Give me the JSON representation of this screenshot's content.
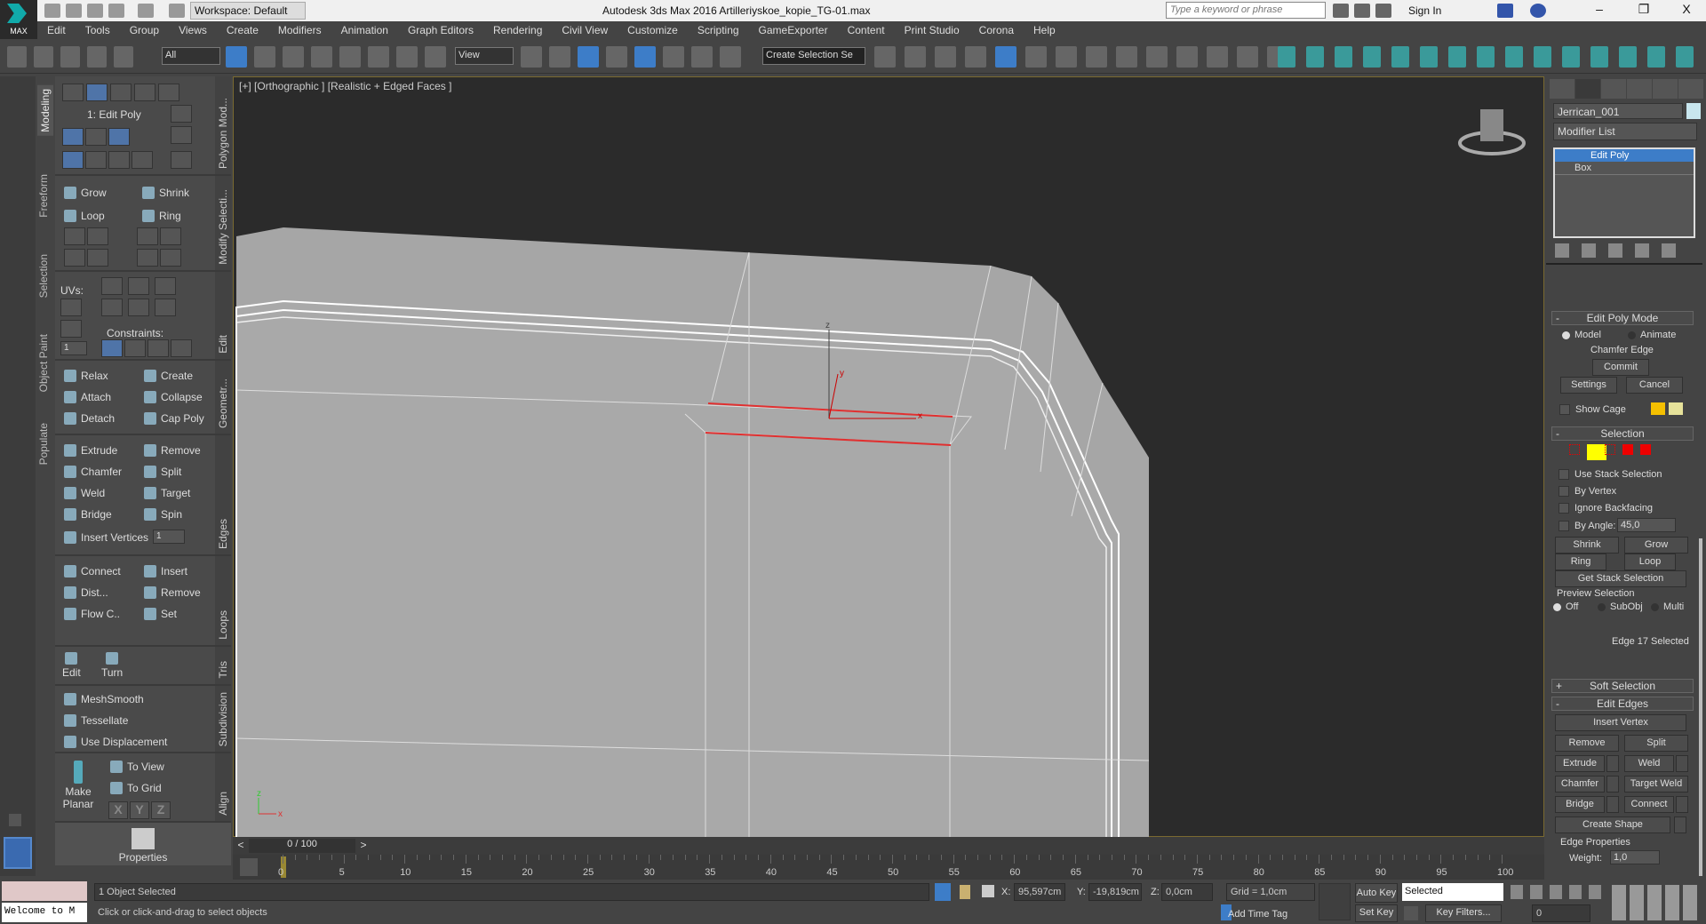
{
  "titlebar": {
    "workspace": "Workspace: Default",
    "app_title": "Autodesk 3ds Max 2016    Artilleriyskoe_kopie_TG-01.max",
    "search_placeholder": "Type a keyword or phrase",
    "sign_in": "Sign In",
    "logo": "MAX",
    "minimize": "–",
    "restore": "❐",
    "close": "X"
  },
  "menu": [
    "Edit",
    "Tools",
    "Group",
    "Views",
    "Create",
    "Modifiers",
    "Animation",
    "Graph Editors",
    "Rendering",
    "Civil View",
    "Customize",
    "Scripting",
    "GameExporter",
    "Content",
    "Print Studio",
    "Corona",
    "Help"
  ],
  "toolbar": {
    "selection_filter": "All",
    "ref_coord": "View",
    "named_sel": "Create Selection Se",
    "snap_value": "3"
  },
  "ribbon_tabs": [
    "Modeling",
    "Freeform",
    "Selection",
    "Object Paint",
    "Populate"
  ],
  "ribbon": {
    "polygon_modeling": {
      "title": "Polygon Mod...",
      "stack_label": "1: Edit Poly"
    },
    "modify_selection": {
      "title": "Modify Selecti...",
      "grow": "Grow",
      "shrink": "Shrink",
      "loop": "Loop",
      "ring": "Ring"
    },
    "edit": {
      "title": "Edit",
      "uvs": "UVs:",
      "constraints": "Constraints:",
      "uv_value": "1"
    },
    "geometry": {
      "title": "Geometr...",
      "items": [
        "Relax",
        "Create",
        "Attach",
        "Collapse",
        "Detach",
        "Cap Poly"
      ]
    },
    "edges": {
      "title": "Edges",
      "items": [
        "Extrude",
        "Remove",
        "Chamfer",
        "Split",
        "Weld",
        "Target",
        "Bridge",
        "Spin"
      ],
      "insert_vertices": "Insert Vertices",
      "insert_value": "1"
    },
    "loops": {
      "title": "Loops",
      "items": [
        "Connect",
        "Insert",
        "Dist...",
        "Remove",
        "Flow C..",
        "Set"
      ]
    },
    "tris": {
      "title": "Tris",
      "edit": "Edit",
      "turn": "Turn"
    },
    "subdivision": {
      "title": "Subdivision",
      "items": [
        "MeshSmooth",
        "Tessellate",
        "Use Displacement"
      ]
    },
    "align": {
      "title": "Align",
      "make_planar": "Make Planar",
      "to_view": "To View",
      "to_grid": "To Grid",
      "x": "X",
      "y": "Y",
      "z": "Z"
    },
    "properties": "Properties"
  },
  "viewport": {
    "label": "[+] [Orthographic ] [Realistic + Edged Faces ]",
    "gizmo_x": "x",
    "gizmo_y": "y",
    "gizmo_z": "z",
    "axis_x": "x",
    "axis_y": "y",
    "axis_z": "z",
    "selected_color": "#e03030"
  },
  "command_panel": {
    "object_name": "Jerrican_001",
    "object_color": "#c8e6ee",
    "modifier_list": "Modifier List",
    "stack": [
      "Edit Poly",
      "Box"
    ],
    "edit_poly_mode": {
      "title": "Edit Poly Mode",
      "model": "Model",
      "animate": "Animate",
      "mode_label": "Chamfer Edge",
      "commit": "Commit",
      "settings": "Settings",
      "cancel": "Cancel",
      "show_cage": "Show Cage",
      "cage_color1": "#f5c000",
      "cage_color2": "#e6e29a"
    },
    "selection": {
      "title": "Selection",
      "use_stack": "Use Stack Selection",
      "by_vertex": "By Vertex",
      "ignore_backfacing": "Ignore Backfacing",
      "by_angle": "By Angle:",
      "angle_value": "45,0",
      "shrink": "Shrink",
      "grow": "Grow",
      "ring": "Ring",
      "loop": "Loop",
      "get_stack": "Get Stack Selection",
      "preview": "Preview Selection",
      "off": "Off",
      "subobj": "SubObj",
      "multi": "Multi",
      "status": "Edge 17 Selected"
    },
    "soft_selection": {
      "title": "Soft Selection"
    },
    "edit_edges": {
      "title": "Edit Edges",
      "insert_vertex": "Insert Vertex",
      "remove": "Remove",
      "split": "Split",
      "extrude": "Extrude",
      "weld": "Weld",
      "chamfer": "Chamfer",
      "target_weld": "Target Weld",
      "bridge": "Bridge",
      "connect": "Connect",
      "create_shape": "Create Shape",
      "edge_properties": "Edge Properties",
      "weight_label": "Weight:",
      "weight_value": "1,0"
    }
  },
  "timeline": {
    "frame": "0 / 100",
    "prev": "<",
    "next": ">",
    "ticks": [
      0,
      5,
      10,
      15,
      20,
      25,
      30,
      35,
      40,
      45,
      50,
      55,
      60,
      65,
      70,
      75,
      80,
      85,
      90,
      95,
      100
    ]
  },
  "status": {
    "maxscript": "Welcome to M",
    "selected": "1 Object Selected",
    "prompt": "Click or click-and-drag to select objects",
    "x_label": "X:",
    "x": "95,597cm",
    "y_label": "Y:",
    "y": "-19,819cm",
    "z_label": "Z:",
    "z": "0,0cm",
    "grid": "Grid = 1,0cm",
    "add_time_tag": "Add Time Tag",
    "auto_key": "Auto Key",
    "set_key": "Set Key",
    "key_mode": "Selected",
    "key_filters": "Key Filters...",
    "frame_value": "0"
  }
}
